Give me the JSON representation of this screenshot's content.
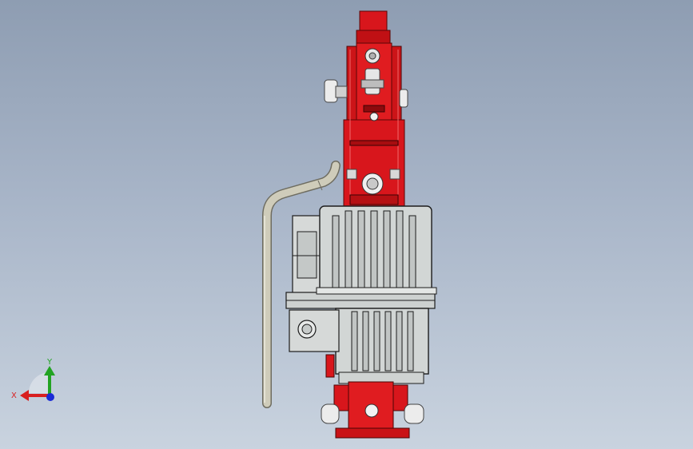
{
  "viewport": {
    "background_top": "#8e9db2",
    "background_bottom": "#c9d3df"
  },
  "model": {
    "accent_color": "#d8161c",
    "metal_color": "#d3d7d6",
    "pipe_color": "#c9c7b3"
  },
  "triad": {
    "x_label": "X",
    "y_label": "Y",
    "x_color": "#d81f1f",
    "y_color": "#22a322",
    "z_color": "#1a2bd6"
  }
}
